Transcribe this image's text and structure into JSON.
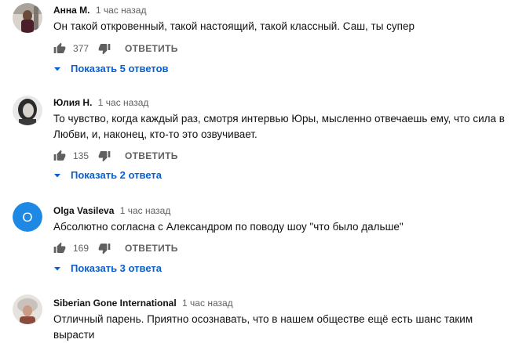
{
  "comments": [
    {
      "author": "Анна М.",
      "time": "1 час назад",
      "lines": [
        "Он такой откровенный, такой настоящий, такой классный. Саш, ты супер"
      ],
      "likes": "377",
      "reply_label": "ОТВЕТИТЬ",
      "show_replies": "Показать 5 ответов"
    },
    {
      "author": "Юлия Н.",
      "time": "1 час назад",
      "lines": [
        "То чувство, когда каждый раз, смотря интервью Юры, мысленно отвечаешь ему, что сила в",
        "Любви, и, наконец, кто-то это озвучивает."
      ],
      "likes": "135",
      "reply_label": "ОТВЕТИТЬ",
      "show_replies": "Показать 2 ответа"
    },
    {
      "author": "Olga Vasileva",
      "time": "1 час назад",
      "avatar_letter": "O",
      "avatar_color": "#1e88e5",
      "lines": [
        "Абсолютно согласна с Александром по поводу шоу \"что было дальше\""
      ],
      "likes": "169",
      "reply_label": "ОТВЕТИТЬ",
      "show_replies": "Показать 3 ответа"
    },
    {
      "author": "Siberian Gone International",
      "time": "1 час назад",
      "lines": [
        "Отличный парень. Приятно осознавать, что в нашем обществе ещё есть шанс таким вырасти"
      ]
    }
  ]
}
